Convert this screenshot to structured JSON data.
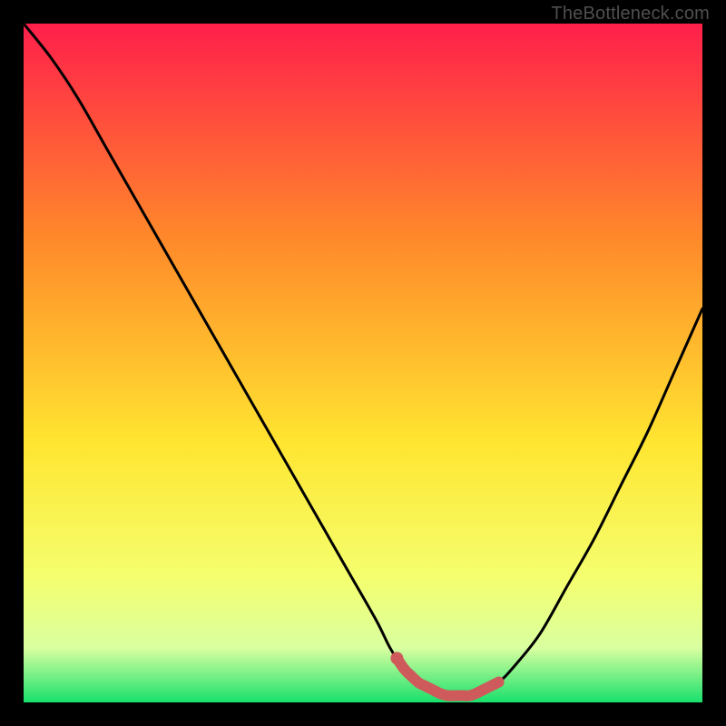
{
  "watermark": "TheBottleneck.com",
  "colors": {
    "background": "#000000",
    "gradient_top": "#ff1f4b",
    "gradient_mid1": "#ff8a2a",
    "gradient_mid2": "#ffe631",
    "gradient_low1": "#f4ff70",
    "gradient_low2": "#d9ffa0",
    "gradient_bottom": "#18e06c",
    "curve": "#000000",
    "highlight": "#cf5a5b"
  },
  "chart_data": {
    "type": "line",
    "title": "",
    "xlabel": "",
    "ylabel": "",
    "ylim": [
      0,
      100
    ],
    "xlim": [
      0,
      100
    ],
    "series": [
      {
        "name": "bottleneck-curve",
        "x": [
          0,
          4,
          8,
          12,
          16,
          20,
          24,
          28,
          32,
          36,
          40,
          44,
          48,
          52,
          54,
          56,
          58,
          60,
          62,
          64,
          66,
          68,
          70,
          72,
          76,
          80,
          84,
          88,
          92,
          96,
          100
        ],
        "values": [
          100,
          95,
          89,
          82,
          75,
          68,
          61,
          54,
          47,
          40,
          33,
          26,
          19,
          12,
          8,
          5,
          3,
          2,
          1,
          1,
          1,
          2,
          3,
          5,
          10,
          17,
          24,
          32,
          40,
          49,
          58
        ]
      }
    ],
    "highlight_range": {
      "x_start": 55,
      "x_end": 70,
      "y": 1
    }
  }
}
